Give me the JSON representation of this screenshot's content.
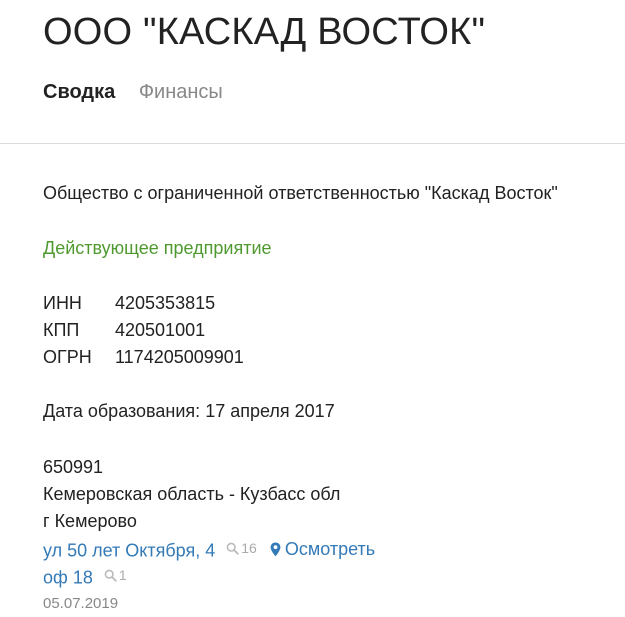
{
  "header": {
    "title": "ООО \"КАСКАД ВОСТОК\""
  },
  "tabs": [
    {
      "label": "Сводка",
      "active": true
    },
    {
      "label": "Финансы",
      "active": false
    }
  ],
  "company": {
    "full_name": "Общество с ограниченной ответственностью \"Каскад Восток\"",
    "status": "Действующее предприятие",
    "status_color": "#4f9a2f",
    "ids": [
      {
        "label": "ИНН",
        "value": "4205353815"
      },
      {
        "label": "КПП",
        "value": "420501001"
      },
      {
        "label": "ОГРН",
        "value": "1174205009901"
      }
    ],
    "founded_label": "Дата образования:",
    "founded_value": "17 апреля 2017"
  },
  "address": {
    "postcode": "650991",
    "region": "Кемеровская область - Кузбасс обл",
    "city": "г Кемерово",
    "street": "ул 50 лет Октября, 4",
    "street_search_count": "16",
    "map_link": "Осмотреть",
    "office": "оф 18",
    "office_search_count": "1",
    "link_color": "#337ab7"
  },
  "updated_date": "05.07.2019"
}
